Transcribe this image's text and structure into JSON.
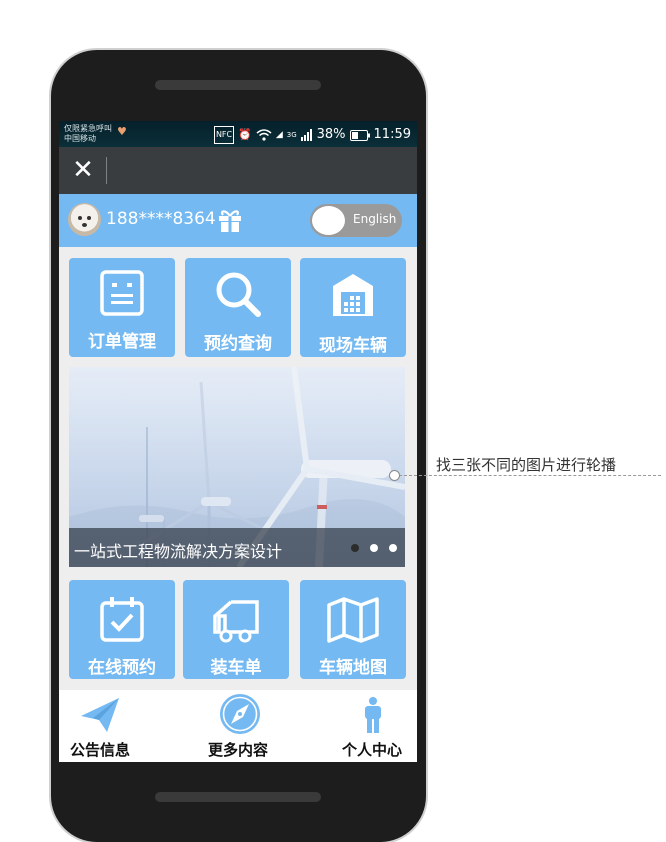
{
  "status_bar": {
    "carrier_line1": "仅限紧急呼叫",
    "carrier_line2": "中国移动",
    "nfc": "NFC",
    "network": "3G",
    "battery": "38%",
    "time": "11:59"
  },
  "user_bar": {
    "phone_number": "188****8364",
    "language_toggle_label": "English"
  },
  "top_tiles": [
    {
      "label": "订单管理",
      "icon": "order-list-icon"
    },
    {
      "label": "预约查询",
      "icon": "search-icon"
    },
    {
      "label": "现场车辆",
      "icon": "warehouse-icon"
    }
  ],
  "banner": {
    "caption": "一站式工程物流解决方案设计",
    "slide_count": 3,
    "active_slide": 0
  },
  "bottom_tiles": [
    {
      "label": "在线预约",
      "icon": "calendar-check-icon"
    },
    {
      "label": "装车单",
      "icon": "truck-icon"
    },
    {
      "label": "车辆地图",
      "icon": "map-icon"
    }
  ],
  "bottom_nav": [
    {
      "label": "公告信息",
      "icon": "paper-plane-icon"
    },
    {
      "label": "更多内容",
      "icon": "compass-icon"
    },
    {
      "label": "个人中心",
      "icon": "person-icon"
    }
  ],
  "annotation": {
    "text": "找三张不同的图片进行轮播"
  },
  "colors": {
    "accent": "#74b9f1",
    "titlebar": "#3a3d40",
    "toggle": "#9a9a9a"
  }
}
